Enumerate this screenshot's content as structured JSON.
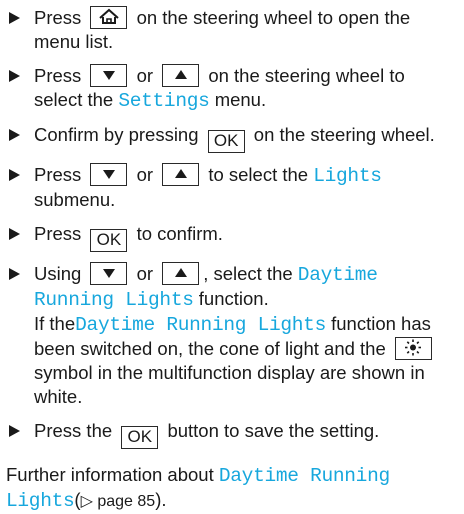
{
  "steps": [
    {
      "parts": [
        "Press",
        "on the steering wheel to open the menu list."
      ]
    },
    {
      "parts": [
        "Press",
        "or",
        "on the steering wheel to select the",
        "Settings",
        "menu."
      ]
    },
    {
      "parts": [
        "Confirm by pressing",
        "OK",
        "on the steering wheel."
      ]
    },
    {
      "parts": [
        "Press",
        "or",
        "to select the",
        "Lights",
        "submenu."
      ]
    },
    {
      "parts": [
        "Press",
        "OK",
        "to confirm."
      ]
    },
    {
      "parts": [
        "Using",
        "or",
        ", select the",
        "Daytime Running Lights",
        "function."
      ],
      "note": [
        "If the",
        "Daytime Running Lights",
        "function has been switched on, the cone of light and the",
        "symbol in the multifunction display are shown in white."
      ]
    },
    {
      "parts": [
        "Press the",
        "OK",
        "button to save the setting."
      ]
    }
  ],
  "footer": {
    "text": "Further information about",
    "highlight": "Daytime Running Lights",
    "ref_open": "(",
    "ref_page": "page 85",
    "ref_close": ")."
  },
  "colors": {
    "highlight": "#17a7dd",
    "text": "#1a1a1a"
  },
  "icons": [
    "home-icon",
    "down-arrow-icon",
    "up-arrow-icon",
    "sun-light-icon",
    "bullet-triangle-icon"
  ]
}
